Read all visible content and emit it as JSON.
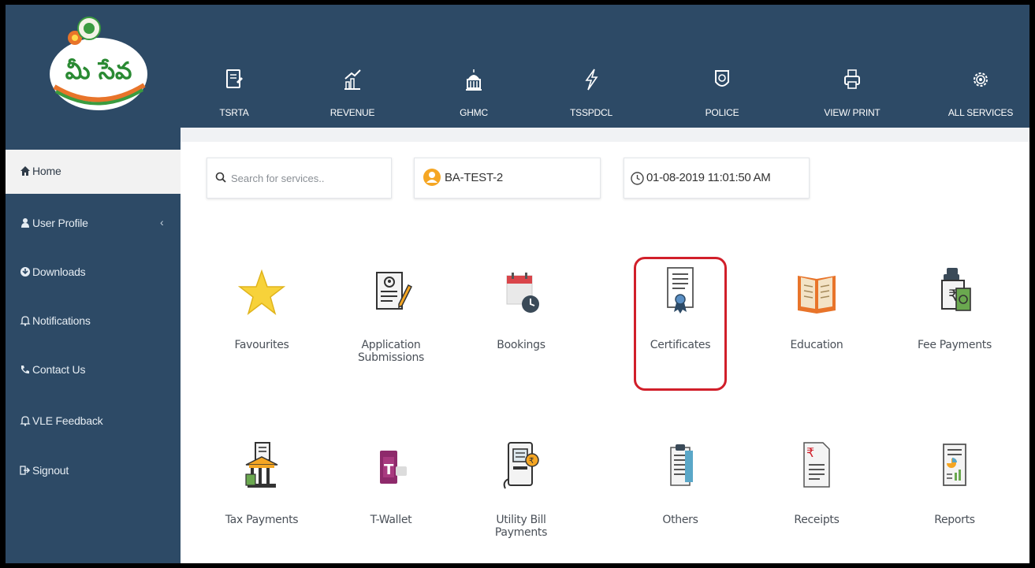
{
  "header": {
    "logo_text": "మీ సేవ",
    "nav": [
      {
        "label": "TSRTA",
        "icon": "document-icon"
      },
      {
        "label": "REVENUE",
        "icon": "growth-icon"
      },
      {
        "label": "GHMC",
        "icon": "building-icon"
      },
      {
        "label": "TSSPDCL",
        "icon": "lightning-icon"
      },
      {
        "label": "POLICE",
        "icon": "badge-icon"
      },
      {
        "label": "VIEW/ PRINT",
        "icon": "printer-icon"
      },
      {
        "label": "ALL SERVICES",
        "icon": "gear-icon"
      }
    ]
  },
  "sidebar": {
    "items": [
      {
        "label": "Home",
        "icon": "home-icon",
        "active": true
      },
      {
        "label": "User Profile",
        "icon": "user-icon",
        "has_chevron": true
      },
      {
        "label": "Downloads",
        "icon": "download-icon"
      },
      {
        "label": "Notifications",
        "icon": "bell-icon"
      },
      {
        "label": "Contact Us",
        "icon": "phone-icon"
      },
      {
        "label": "VLE Feedback",
        "icon": "bell-icon"
      },
      {
        "label": "Signout",
        "icon": "signout-icon"
      }
    ]
  },
  "toolbar": {
    "search_placeholder": "Search for services..",
    "user_name": "BA-TEST-2",
    "datetime": "01-08-2019 11:01:50 AM"
  },
  "tiles": [
    {
      "label": "Favourites",
      "icon": "star-icon"
    },
    {
      "label": "Application\nSubmissions",
      "icon": "application-form-icon"
    },
    {
      "label": "Bookings",
      "icon": "calendar-clock-icon"
    },
    {
      "label": "Certificates",
      "icon": "certificate-icon",
      "highlighted": true
    },
    {
      "label": "Education",
      "icon": "book-icon"
    },
    {
      "label": "Fee Payments",
      "icon": "fee-payment-icon"
    },
    {
      "label": "Tax Payments",
      "icon": "tax-building-icon"
    },
    {
      "label": "T-Wallet",
      "icon": "wallet-icon"
    },
    {
      "label": "Utility Bill\nPayments",
      "icon": "utility-bill-icon"
    },
    {
      "label": "Others",
      "icon": "clipboard-icon"
    },
    {
      "label": "Receipts",
      "icon": "receipt-icon"
    },
    {
      "label": "Reports",
      "icon": "report-chart-icon"
    }
  ],
  "colors": {
    "header_bg": "#2d4a66",
    "highlight": "#d11f2a",
    "star": "#f7d23a"
  }
}
